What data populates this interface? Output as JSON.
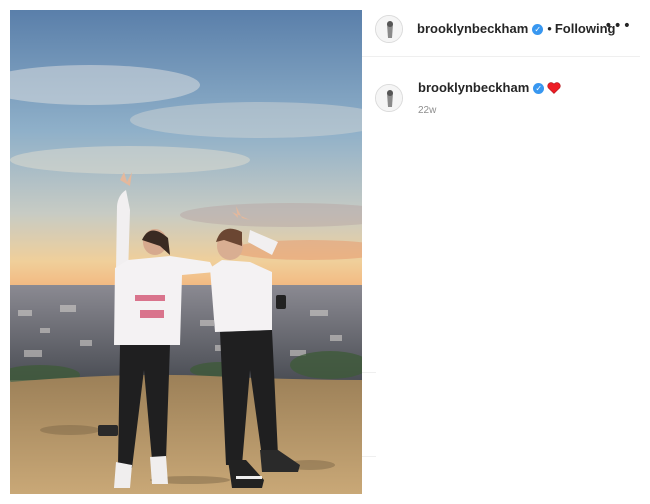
{
  "post": {
    "username": "brooklynbeckham",
    "verified_icon": "verified-badge-icon",
    "separator": "•",
    "follow_status": "Following",
    "more_icon": "more-options-icon",
    "more_glyph": "•••"
  },
  "caption": {
    "username": "brooklynbeckham",
    "emoji": "heart-emoji",
    "time": "22w"
  },
  "colors": {
    "verified": "#3897f0",
    "heart": "#ed1c24",
    "secondary_text": "#8e8e8e"
  }
}
